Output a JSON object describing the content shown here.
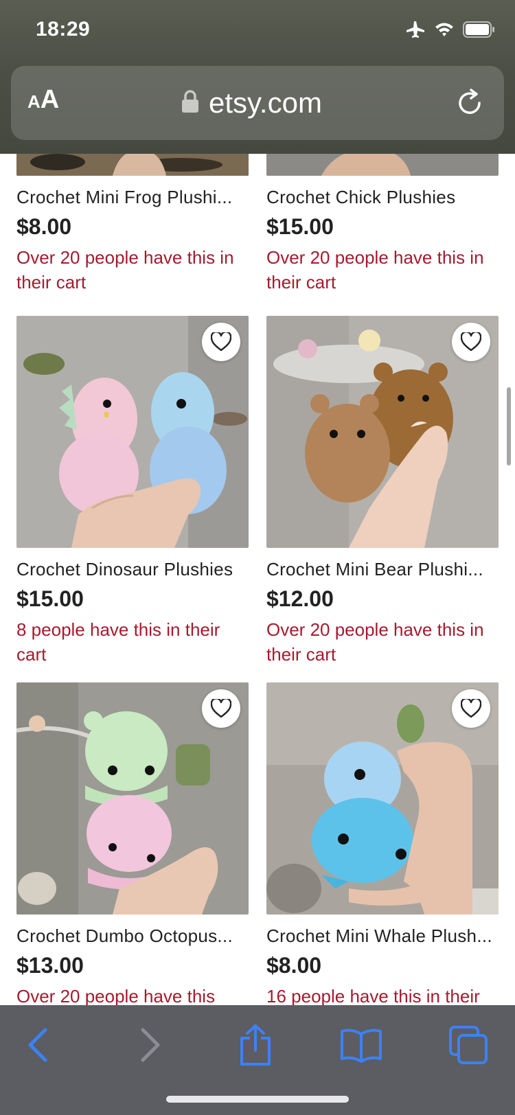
{
  "status_bar": {
    "time": "18:29"
  },
  "browser": {
    "aa_small": "A",
    "aa_big": "A",
    "url": "etsy.com"
  },
  "listings": [
    {
      "title": "Crochet Mini Frog Plushi...",
      "price": "$8.00",
      "cart_note": "Over 20 people have this in their cart"
    },
    {
      "title": "Crochet Chick Plushies",
      "price": "$15.00",
      "cart_note": "Over 20 people have this in their cart"
    },
    {
      "title": "Crochet Dinosaur Plushies",
      "price": "$15.00",
      "cart_note": "8 people have this in their cart"
    },
    {
      "title": "Crochet Mini Bear Plushi...",
      "price": "$12.00",
      "cart_note": "Over 20 people have this in their cart"
    },
    {
      "title": "Crochet Dumbo Octopus...",
      "price": "$13.00",
      "cart_note": "Over 20 people have this"
    },
    {
      "title": "Crochet Mini Whale Plush...",
      "price": "$8.00",
      "cart_note": "16 people have this in their"
    }
  ],
  "colors": {
    "cart_note": "#a61a2e",
    "toolbar_accent": "#3b82f6",
    "toolbar_disabled": "#8a8d93"
  },
  "icons": {
    "airplane": "airplane-icon",
    "wifi": "wifi-icon",
    "battery": "battery-icon",
    "lock": "lock-icon",
    "reload": "reload-icon",
    "favorite": "heart-icon",
    "back": "chevron-left-icon",
    "forward": "chevron-right-icon",
    "share": "share-icon",
    "bookmarks": "book-icon",
    "tabs": "tabs-icon"
  }
}
